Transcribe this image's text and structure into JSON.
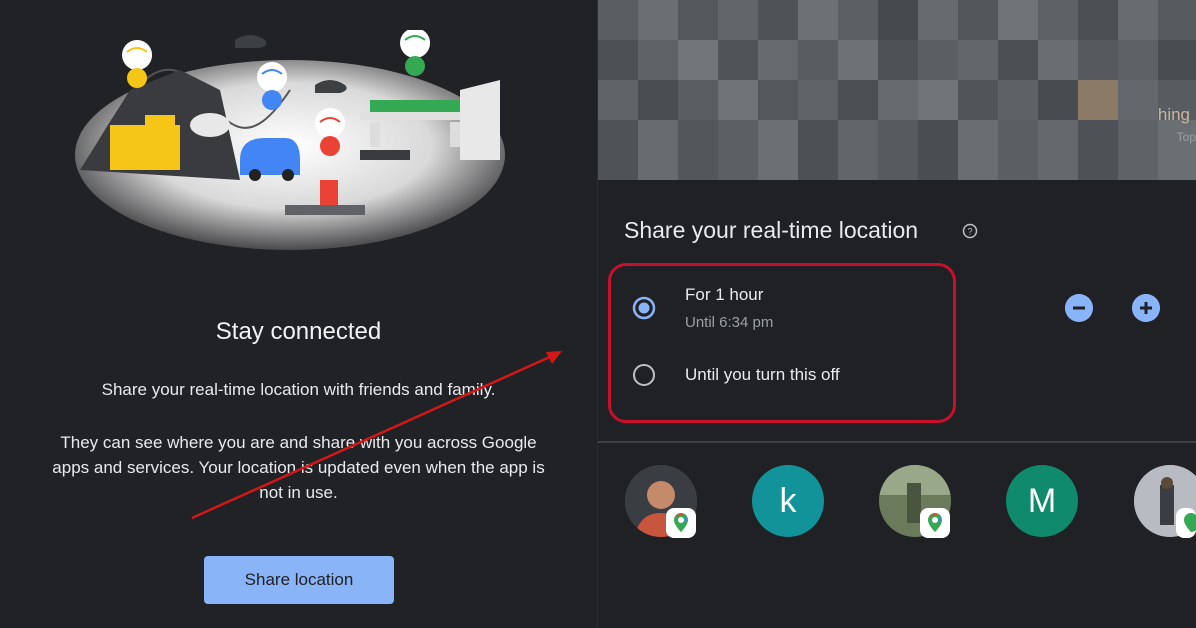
{
  "left": {
    "title": "Stay connected",
    "description_1": "Share your real-time location with friends and family.",
    "description_2": "They can see where you are and share with you across Google apps and services. Your location is updated even when the app is not in use.",
    "share_button": "Share location"
  },
  "right": {
    "map_label": "hing",
    "map_label_2": "Top",
    "share_title": "Share your real-time location",
    "help_icon": "help-circle-icon",
    "option_1": {
      "title": "For 1 hour",
      "subtitle": "Until 6:34 pm",
      "selected": true
    },
    "option_2": {
      "title": "Until you turn this off",
      "selected": false
    },
    "contacts": [
      {
        "type": "photo",
        "has_maps_badge": true
      },
      {
        "type": "letter",
        "letter": "k",
        "color": "#12939a",
        "has_maps_badge": false
      },
      {
        "type": "photo",
        "has_maps_badge": true
      },
      {
        "type": "letter",
        "letter": "M",
        "color": "#0f8a6c",
        "has_maps_badge": false
      },
      {
        "type": "photo",
        "has_maps_badge": true
      }
    ]
  },
  "colors": {
    "accent": "#8ab4f8",
    "highlight": "#c8102e",
    "background": "#202124"
  }
}
